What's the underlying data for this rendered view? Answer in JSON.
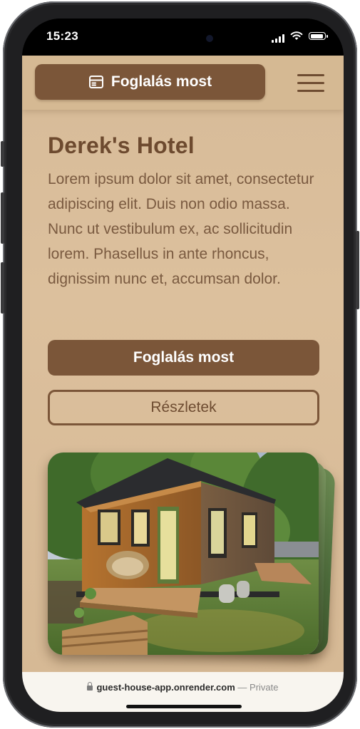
{
  "status_bar": {
    "time": "15:23"
  },
  "navbar": {
    "book_label": "Foglalás most",
    "menu_icon": "hamburger-icon",
    "book_icon": "calendar-icon"
  },
  "hero": {
    "title": "Derek's Hotel",
    "text": "Lorem ipsum dolor sit amet, consectetur adipiscing elit. Duis non odio massa. Nunc ut vestibulum ex, ac sollicitudin lorem. Phasellus in ante rhoncus, dignissim nunc et, accumsan dolor.",
    "primary_button": "Foglalás most",
    "secondary_button": "Részletek"
  },
  "browser": {
    "url": "guest-house-app.onrender.com",
    "separator": "—",
    "mode": "Private"
  },
  "colors": {
    "brand": "#7b5639",
    "background": "#d7bb98",
    "title": "#6d4a2f",
    "text": "#7a5a40"
  }
}
